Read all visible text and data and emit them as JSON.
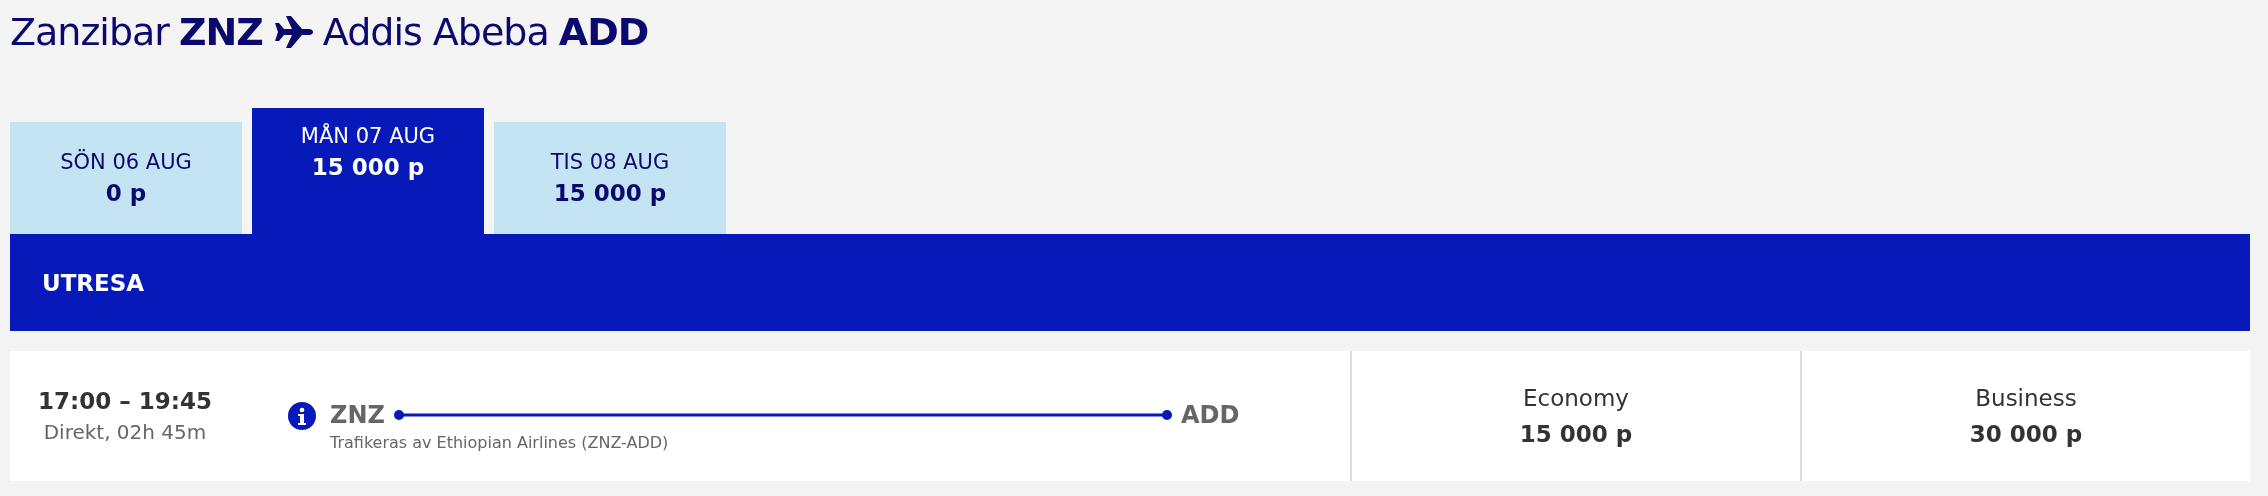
{
  "route": {
    "origin_city": "Zanzibar",
    "origin_code": "ZNZ",
    "destination_city": "Addis Abeba",
    "destination_code": "ADD"
  },
  "date_tabs": [
    {
      "date": "SÖN 06 AUG",
      "price": "0 p",
      "selected": false
    },
    {
      "date": "MÅN 07 AUG",
      "price": "15 000 p",
      "selected": true
    },
    {
      "date": "TIS 08 AUG",
      "price": "15 000 p",
      "selected": false
    }
  ],
  "section_title": "UTRESA",
  "flight": {
    "times": "17:00 – 19:45",
    "duration": "Direkt, 02h 45m",
    "from": "ZNZ",
    "to": "ADD",
    "operator": "Trafikeras av Ethiopian Airlines (ZNZ-ADD)",
    "fares": [
      {
        "cabin": "Economy",
        "price": "15 000 p"
      },
      {
        "cabin": "Business",
        "price": "30 000 p"
      }
    ]
  }
}
